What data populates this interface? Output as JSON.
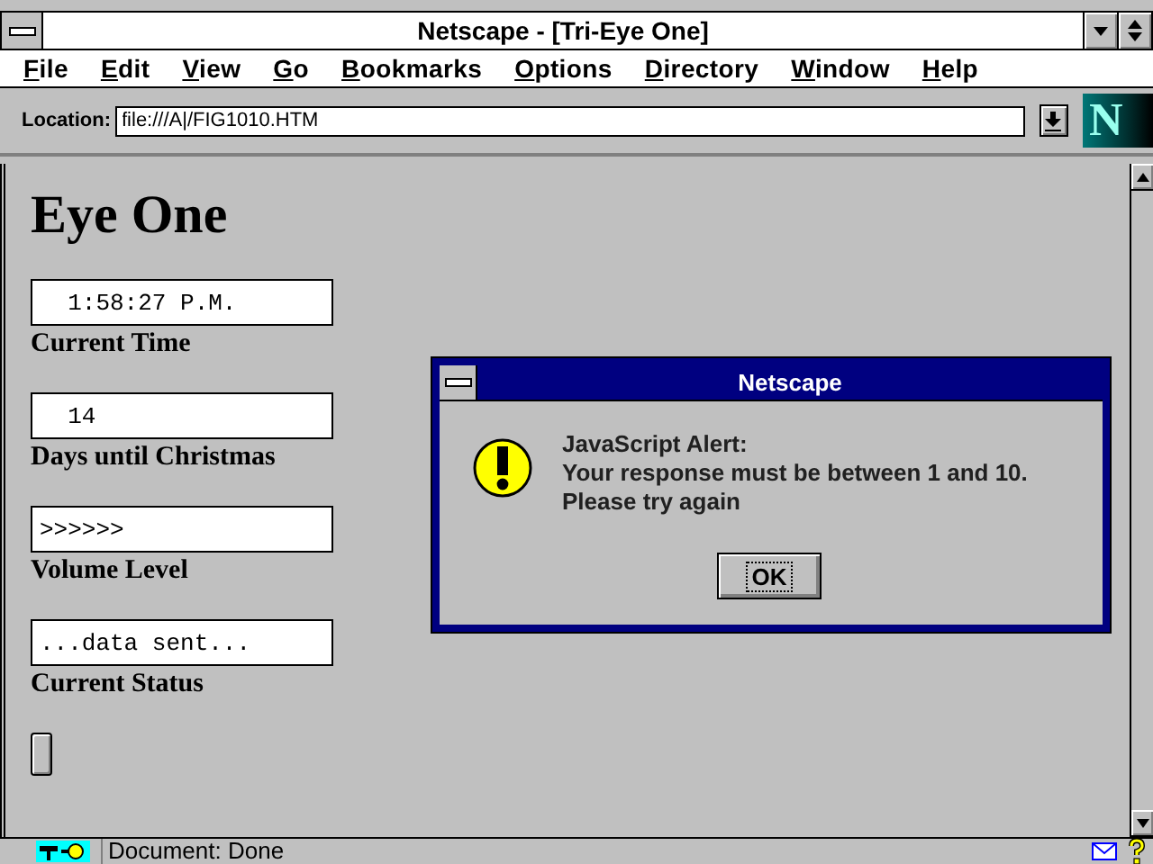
{
  "window": {
    "title": "Netscape - [Tri-Eye One]"
  },
  "menu": [
    "File",
    "Edit",
    "View",
    "Go",
    "Bookmarks",
    "Options",
    "Directory",
    "Window",
    "Help"
  ],
  "location": {
    "label": "Location:",
    "value": "file:///A|/FIG1010.HTM"
  },
  "logo": "N",
  "page": {
    "heading": "Eye One",
    "fields": [
      {
        "value": "  1:58:27 P.M.",
        "label": "Current Time"
      },
      {
        "value": "  14",
        "label": "Days until Christmas"
      },
      {
        "value": ">>>>>>",
        "label": "Volume Level"
      },
      {
        "value": "...data sent...",
        "label": "Current Status"
      }
    ]
  },
  "alert": {
    "title": "Netscape",
    "lines": [
      "JavaScript Alert:",
      "Your response must be between 1 and 10.",
      "Please try again"
    ],
    "button": "OK"
  },
  "status_bar": {
    "text": "Document: Done"
  }
}
